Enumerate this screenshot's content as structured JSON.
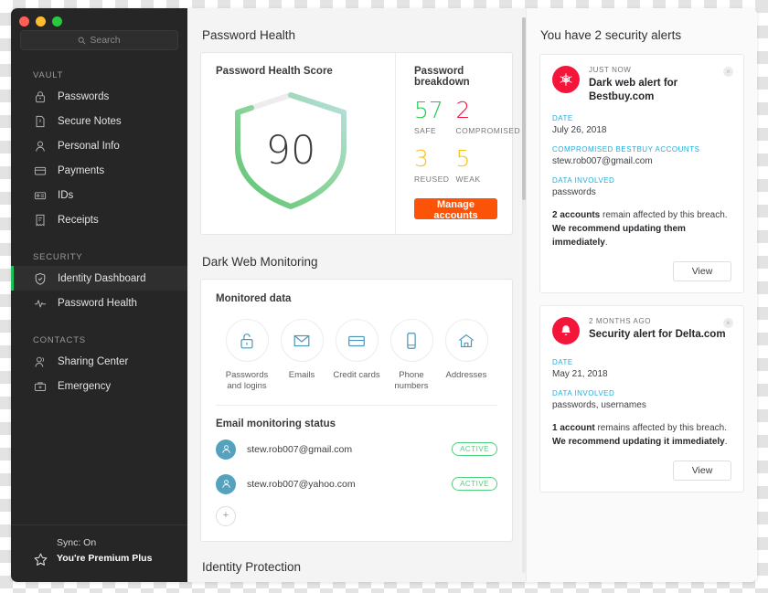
{
  "window": {
    "traffic_lights": [
      "close",
      "minimize",
      "zoom"
    ]
  },
  "sidebar": {
    "search": {
      "placeholder": "Search",
      "value": ""
    },
    "groups": [
      {
        "title": "VAULT",
        "items": [
          {
            "label": "Passwords",
            "icon": "lock-icon",
            "active": false
          },
          {
            "label": "Secure Notes",
            "icon": "note-icon",
            "active": false
          },
          {
            "label": "Personal Info",
            "icon": "person-icon",
            "active": false
          },
          {
            "label": "Payments",
            "icon": "card-icon",
            "active": false
          },
          {
            "label": "IDs",
            "icon": "id-icon",
            "active": false
          },
          {
            "label": "Receipts",
            "icon": "receipt-icon",
            "active": false
          }
        ]
      },
      {
        "title": "SECURITY",
        "items": [
          {
            "label": "Identity Dashboard",
            "icon": "shield-icon",
            "active": true
          },
          {
            "label": "Password Health",
            "icon": "pulse-icon",
            "active": false
          }
        ]
      },
      {
        "title": "CONTACTS",
        "items": [
          {
            "label": "Sharing Center",
            "icon": "share-person-icon",
            "active": false
          },
          {
            "label": "Emergency",
            "icon": "briefcase-icon",
            "active": false
          }
        ]
      }
    ],
    "footer": {
      "sync": "Sync: On",
      "plan": "You're Premium Plus",
      "icon": "star-icon"
    }
  },
  "main": {
    "password_health": {
      "heading": "Password Health",
      "score_title": "Password Health Score",
      "score": "90",
      "breakdown_title": "Password breakdown",
      "breakdown": [
        {
          "value": "57",
          "label": "SAFE",
          "color": "#28c84a"
        },
        {
          "value": "2",
          "label": "COMPROMISED",
          "color": "#f5153b"
        },
        {
          "value": "3",
          "label": "REUSED",
          "color": "#f5c518"
        },
        {
          "value": "5",
          "label": "WEAK",
          "color": "#f5c518"
        }
      ],
      "manage_label": "Manage accounts",
      "manage_color": "#fb5408"
    },
    "dark_web": {
      "heading": "Dark Web Monitoring",
      "monitored_title": "Monitored data",
      "monitored": [
        {
          "label": "Passwords and logins",
          "icon": "lock-open-icon"
        },
        {
          "label": "Emails",
          "icon": "envelope-icon"
        },
        {
          "label": "Credit cards",
          "icon": "credit-card-icon"
        },
        {
          "label": "Phone numbers",
          "icon": "phone-icon"
        },
        {
          "label": "Addresses",
          "icon": "home-icon"
        }
      ],
      "email_status_title": "Email monitoring status",
      "emails": [
        {
          "address": "stew.rob007@gmail.com",
          "status": "ACTIVE",
          "icon": "avatar-icon"
        },
        {
          "address": "stew.rob007@yahoo.com",
          "status": "ACTIVE",
          "icon": "avatar-icon"
        }
      ],
      "add_label": "+"
    },
    "identity_protection": {
      "heading": "Identity Protection"
    }
  },
  "alerts": {
    "title": "You have 2 security alerts",
    "date_label": "DATE",
    "data_label": "DATA INVOLVED",
    "view_label": "View",
    "close_label": "×",
    "items": [
      {
        "when": "JUST NOW",
        "title": "Dark web alert for Bestbuy.com",
        "icon": "spider-web-icon",
        "date_label": "DATE",
        "date": "July 26, 2018",
        "accounts_label": "COMPROMISED BESTBUY ACCOUNTS",
        "accounts": "stew.rob007@gmail.com",
        "data_label": "DATA INVOLVED",
        "data": "passwords",
        "body_lead": "2 accounts",
        "body_mid": " remain affected by this breach. ",
        "body_bold": "We recommend updating them immediately",
        "body_end": ".",
        "view_label": "View"
      },
      {
        "when": "2 MONTHS AGO",
        "title": "Security alert for Delta.com",
        "icon": "bell-icon",
        "date_label": "DATE",
        "date": "May 21, 2018",
        "data_label": "DATA INVOLVED",
        "data": "passwords, usernames",
        "body_lead": "1 account",
        "body_mid": " remains affected by this breach. ",
        "body_bold": "We recommend updating it immediately",
        "body_end": ".",
        "view_label": "View"
      }
    ]
  }
}
